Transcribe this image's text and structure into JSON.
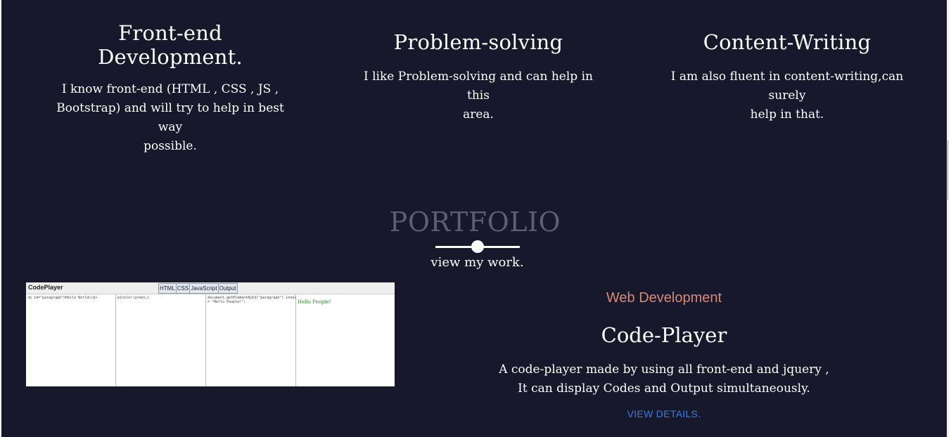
{
  "skills": [
    {
      "title": "Front-end Development.",
      "line1": "I know front-end (HTML , CSS , JS ,",
      "line2": "Bootstrap) and will try to help in best way",
      "line3": "possible."
    },
    {
      "title": "Problem-solving",
      "line1": "I like Problem-solving and can help in this",
      "line2": "area."
    },
    {
      "title": "Content-Writing",
      "line1": "I am also fluent in content-writing,can surely",
      "line2": "help in that."
    }
  ],
  "portfolio": {
    "title": "PORTFOLIO",
    "subtitle": "view my work."
  },
  "thumbnail": {
    "logo": "CodePlayer",
    "tabs": [
      "HTML",
      "CSS",
      "JavaScript",
      "Output"
    ],
    "html_code": "<p id=\"paragraph\">Hello World</p>",
    "css_code": "p{color:green;}",
    "js_code": "document.getElementById(\"paragraph\").innerHTML = \"Hello People!\";",
    "output": "Hello People!"
  },
  "project": {
    "category": "Web Development",
    "title": "Code-Player",
    "desc_line1": "A code-player made by using all front-end and jquery ,",
    "desc_line2": "It can display Codes and Output simultaneously.",
    "link": "VIEW DETAILS."
  },
  "colors": {
    "background": "#18182c",
    "accent_category": "#d48a76",
    "link": "#3d7be0",
    "heading_muted": "#5e5e70"
  }
}
